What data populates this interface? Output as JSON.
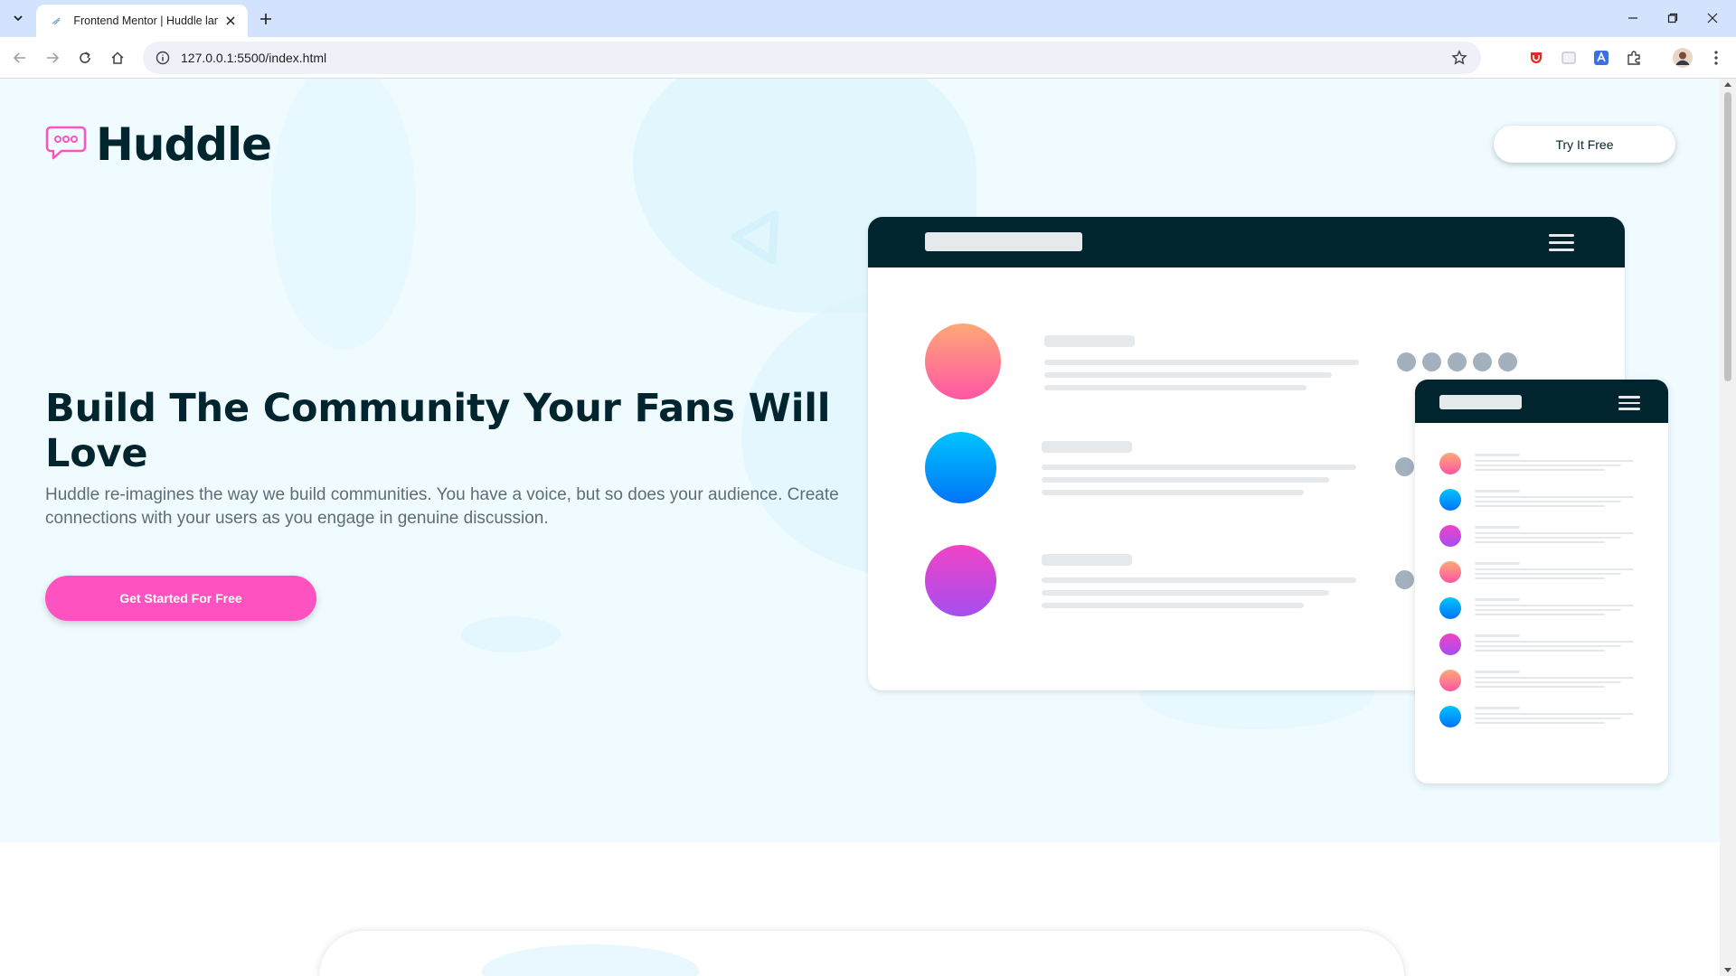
{
  "browser": {
    "tab_title": "Frontend Mentor | Huddle land",
    "url": "127.0.0.1:5500/index.html"
  },
  "page": {
    "logo_text": "Huddle",
    "try_button": "Try It Free",
    "headline": "Build The Community Your Fans Will Love",
    "description": "Huddle re-imagines the way we build communities. You have a voice, but so does your audience. Create connections with your users as you engage in genuine discussion.",
    "cta_button": "Get Started For Free"
  },
  "colors": {
    "dark_navy": "#00252e",
    "pink": "#ff52c1",
    "hero_bg": "#f0fbff",
    "gray_text": "#5e6d75"
  }
}
